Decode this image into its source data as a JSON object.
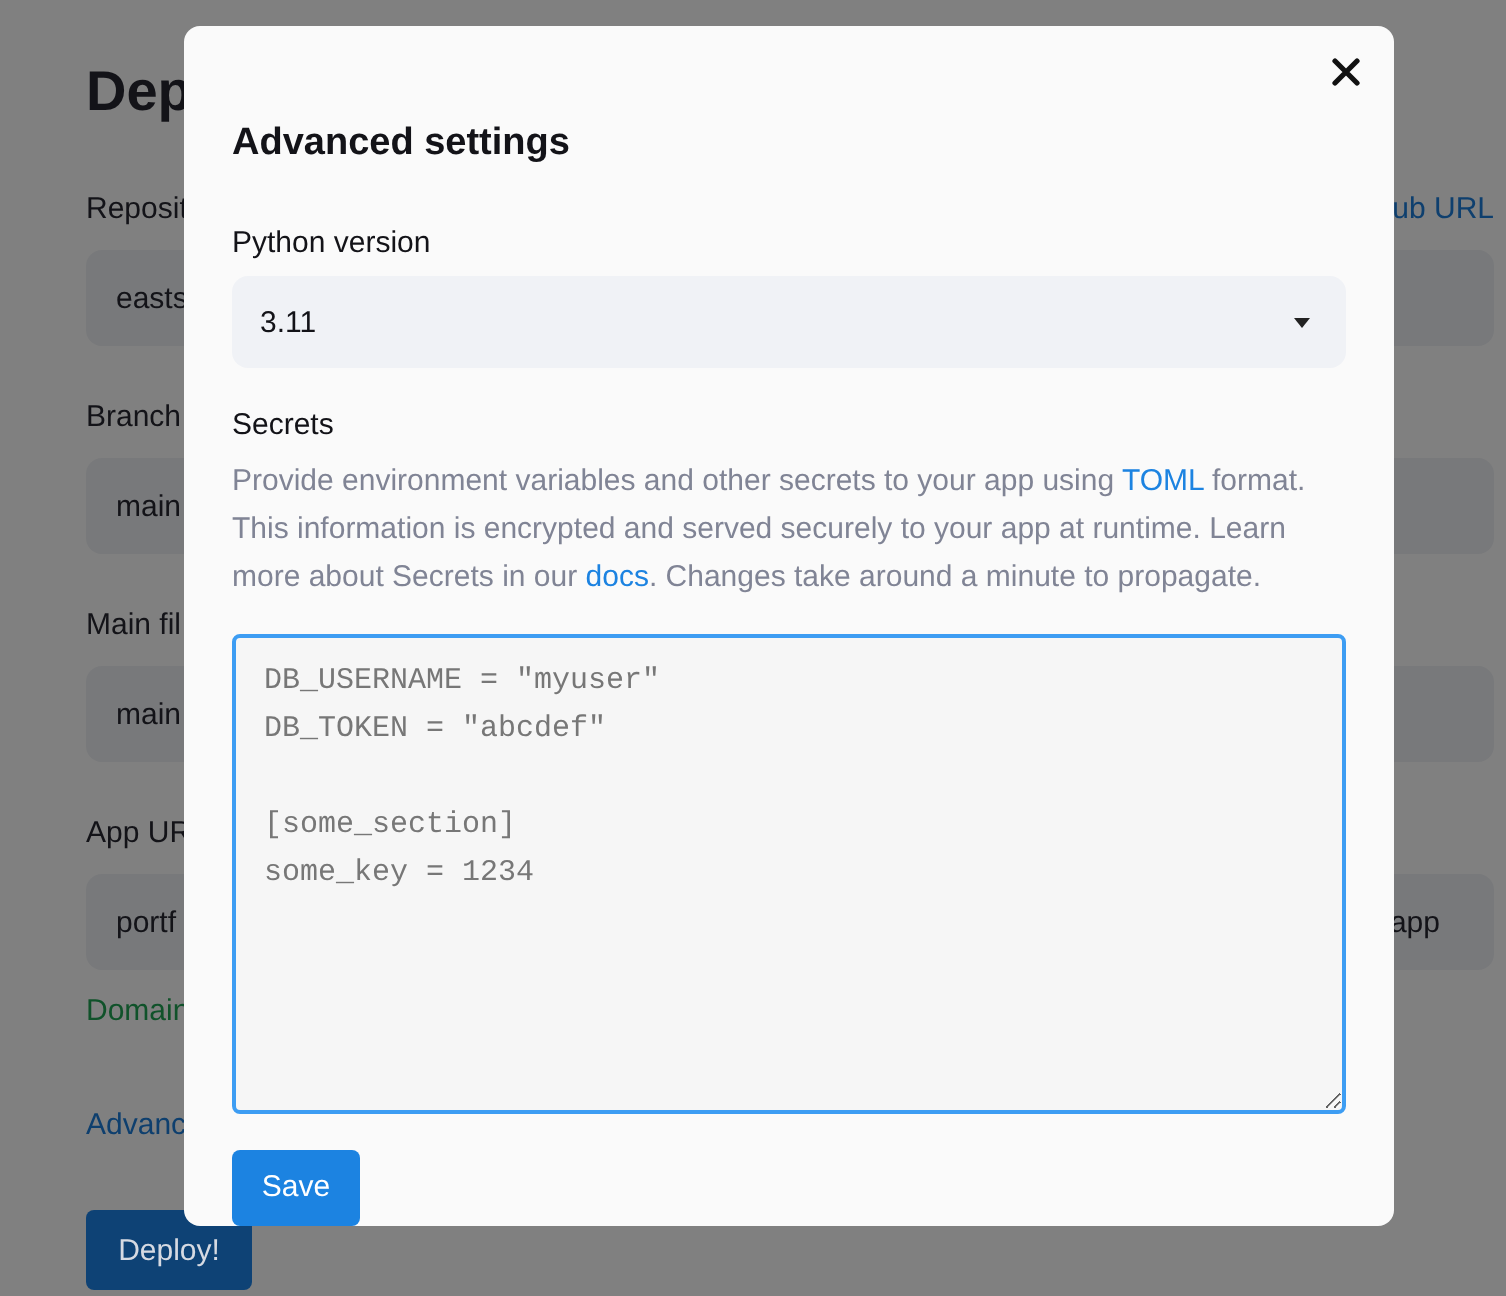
{
  "page": {
    "title": "Dep",
    "fields": [
      {
        "label": "Reposit",
        "link": "ub URL",
        "value": "easts"
      },
      {
        "label": "Branch",
        "value": "main"
      },
      {
        "label": "Main fil",
        "value": "main"
      },
      {
        "label": "App UR",
        "value": "portf",
        "suffix": "app"
      }
    ],
    "domain_note": "Domain",
    "advanced_link": "Advanc",
    "deploy_button": "Deploy!"
  },
  "modal": {
    "title": "Advanced settings",
    "python_label": "Python version",
    "python_value": "3.11",
    "secrets_label": "Secrets",
    "secrets_help": [
      {
        "kind": "text",
        "text": "Provide environment variables and other secrets to your app using "
      },
      {
        "kind": "link",
        "text": "TOML"
      },
      {
        "kind": "text",
        "text": " format. This information is encrypted and served securely to your app at runtime. Learn more about Secrets in our "
      },
      {
        "kind": "link",
        "text": "docs"
      },
      {
        "kind": "text",
        "text": ". Changes take around a minute to propagate."
      }
    ],
    "secrets_placeholder": "DB_USERNAME = \"myuser\"\nDB_TOKEN = \"abcdef\"\n\n[some_section]\nsome_key = 1234",
    "save_button": "Save"
  }
}
